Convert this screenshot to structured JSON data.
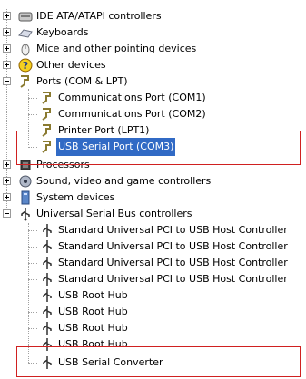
{
  "colors": {
    "highlight_border": "#d02020",
    "selection": "#316ac5"
  },
  "tree": {
    "ide": "IDE ATA/ATAPI controllers",
    "keyboards": "Keyboards",
    "mice": "Mice and other pointing devices",
    "other": "Other devices",
    "ports": {
      "label": "Ports (COM & LPT)",
      "children": [
        "Communications Port (COM1)",
        "Communications Port (COM2)",
        "Printer Port (LPT1)",
        "USB Serial Port (COM3)"
      ]
    },
    "processors": "Processors",
    "sound": "Sound, video and game controllers",
    "system": "System devices",
    "usb": {
      "label": "Universal Serial Bus controllers",
      "children": [
        "Standard Universal PCI to USB Host Controller",
        "Standard Universal PCI to USB Host Controller",
        "Standard Universal PCI to USB Host Controller",
        "Standard Universal PCI to USB Host Controller",
        "USB Root Hub",
        "USB Root Hub",
        "USB Root Hub",
        "USB Root Hub",
        "USB Serial Converter"
      ]
    }
  },
  "icons": {
    "ide": "ide-controller-icon",
    "keyboards": "keyboard-icon",
    "mice": "mouse-icon",
    "other": "unknown-device-icon",
    "ports": "port-icon",
    "processors": "processor-icon",
    "sound": "sound-icon",
    "system": "system-device-icon",
    "usb": "usb-icon"
  }
}
